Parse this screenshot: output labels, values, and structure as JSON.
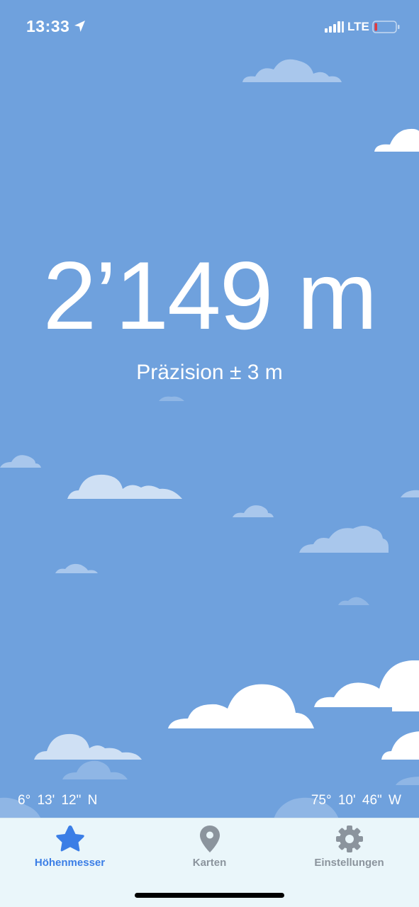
{
  "status_bar": {
    "time": "13:33",
    "network": "LTE",
    "battery_color": "#e0393e"
  },
  "altimeter": {
    "altitude": "2’149 m",
    "precision": "Präzision ± 3 m"
  },
  "coordinates": {
    "latitude": "6°  13'  12\" N",
    "longitude": "75°  10'  46\" W"
  },
  "tabs": [
    {
      "label": "Höhenmesser",
      "icon": "star-icon",
      "active": true
    },
    {
      "label": "Karten",
      "icon": "map-pin-icon",
      "active": false
    },
    {
      "label": "Einstellungen",
      "icon": "gear-icon",
      "active": false
    }
  ],
  "colors": {
    "sky": "#6fa1dd",
    "active_tab": "#3b7ee6",
    "inactive_tab": "#8b949d",
    "tab_bar_bg": "#eaf6fa"
  }
}
